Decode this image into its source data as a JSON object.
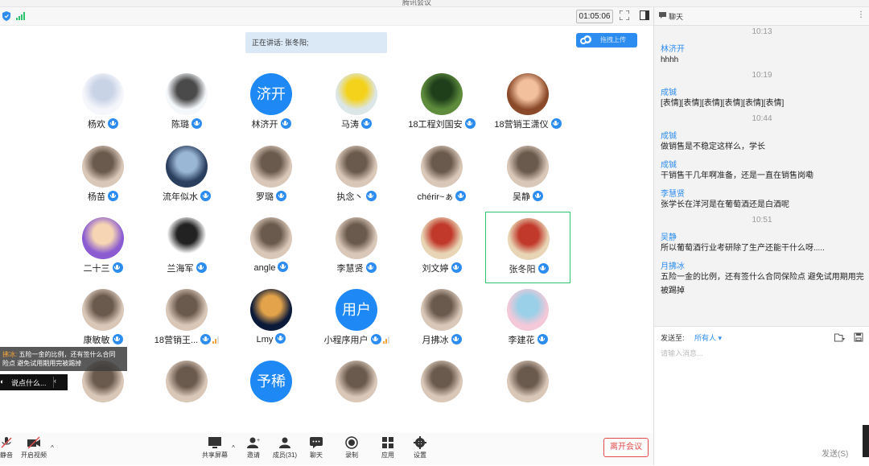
{
  "window": {
    "title": "腾讯会议"
  },
  "toolbar": {
    "timer": "01:05:06"
  },
  "speaker_banner": "正在讲话: 张冬阳;",
  "upload_button": "拖拽上传",
  "participants": [
    {
      "name": "杨欢",
      "avatar": "cartoon-sheep"
    },
    {
      "name": "陈璐",
      "avatar": "panda"
    },
    {
      "name": "林济开",
      "avatar_text": "济开",
      "color": "#1e88f5"
    },
    {
      "name": "马涛",
      "avatar": "yellow-figure"
    },
    {
      "name": "18工程刘国安",
      "avatar": "landscape"
    },
    {
      "name": "18营销王潇仪",
      "avatar": "anime-girl"
    },
    {
      "name": "杨苗",
      "avatar": "photo"
    },
    {
      "name": "流年似水",
      "avatar": "sky"
    },
    {
      "name": "罗璐",
      "avatar": "photo"
    },
    {
      "name": "执念丶",
      "avatar": "photo"
    },
    {
      "name": "chérir~ぁ",
      "avatar": "photo"
    },
    {
      "name": "吴静",
      "avatar": "photo"
    },
    {
      "name": "二十三",
      "avatar": "cartoon"
    },
    {
      "name": "兰海军",
      "avatar": "sketch"
    },
    {
      "name": "angle",
      "avatar": "photo"
    },
    {
      "name": "李慧贤",
      "avatar": "photo"
    },
    {
      "name": "刘文婷",
      "avatar": "cartoon-kids"
    },
    {
      "name": "张冬阳",
      "avatar": "cartoon-kids"
    },
    {
      "name": "康敏敏",
      "avatar": "photo"
    },
    {
      "name": "18营销王...",
      "avatar": "photo"
    },
    {
      "name": "Lmy",
      "avatar": "night"
    },
    {
      "name": "小程序用户",
      "avatar_text": "用户",
      "color": "#1e88f5"
    },
    {
      "name": "月拂冰",
      "avatar": "photo"
    },
    {
      "name": "李建花",
      "avatar": "anime"
    },
    {
      "name": "",
      "avatar": "photo"
    },
    {
      "name": "",
      "avatar": "photo"
    },
    {
      "name": "",
      "avatar_text": "予稀",
      "color": "#1e88f5"
    },
    {
      "name": "",
      "avatar": "photo"
    },
    {
      "name": "",
      "avatar": "photo"
    },
    {
      "name": "",
      "avatar": "photo"
    }
  ],
  "notification": {
    "sender": "拂冰:",
    "text": "五险一金的比例，还有签什么合同",
    "text2": "险点 避免试用期用完被踢掉"
  },
  "quick_bar": {
    "label": "说点什么..."
  },
  "bottom_bar": {
    "mute": "静音",
    "video": "开启视频",
    "share": "共享屏幕",
    "invite": "邀请",
    "members": "成员(31)",
    "chat": "聊天",
    "record": "录制",
    "apps": "应用",
    "settings": "设置",
    "leave": "离开会议"
  },
  "chat": {
    "title": "聊天",
    "messages": [
      {
        "time": "10:13"
      },
      {
        "sender": "林济开",
        "text": "hhhh"
      },
      {
        "time": "10:19"
      },
      {
        "sender": "成铖",
        "text": "[表情][表情][表情][表情][表情][表情]"
      },
      {
        "time": "10:44"
      },
      {
        "sender": "成铖",
        "text": "做销售是不稳定这样么，学长"
      },
      {
        "sender": "成铖",
        "text": "干销售干几年啊准备，还是一直在销售岗嘞"
      },
      {
        "sender": "李慧贤",
        "text": "张学长在洋河是在葡萄酒还是白酒呢"
      },
      {
        "time": "10:51"
      },
      {
        "sender": "吴静",
        "text": "所以葡萄酒行业考研除了生产还能干什么呀....."
      },
      {
        "sender": "月拂冰",
        "text": "五险一金的比例，还有签什么合同保险点 避免试用期用完被踢掉"
      }
    ],
    "send_to_label": "发送至:",
    "send_to_value": "所有人 ▾",
    "input_placeholder": "请输入消息...",
    "send_button": "发送(S)"
  }
}
